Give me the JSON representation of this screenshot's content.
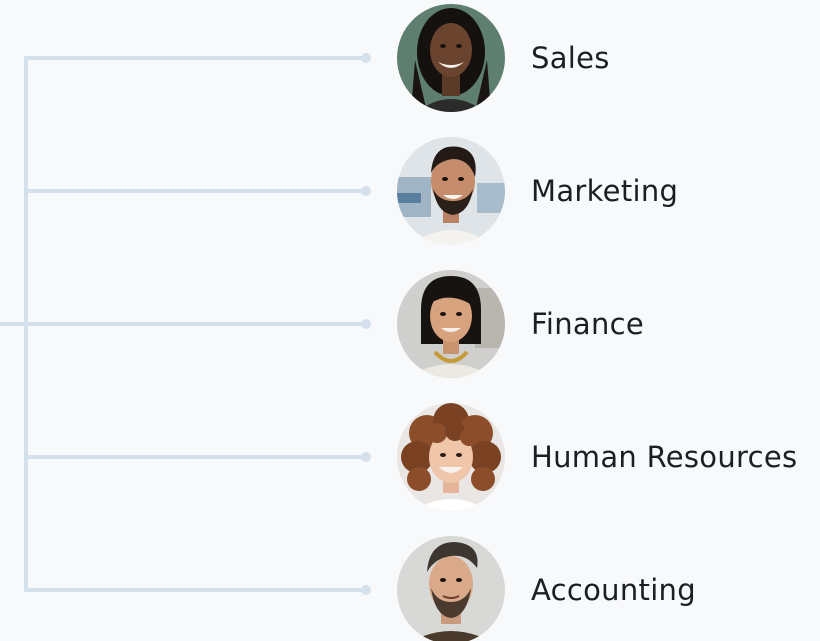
{
  "departments": [
    {
      "label": "Sales",
      "avatar": "woman-braids-avatar"
    },
    {
      "label": "Marketing",
      "avatar": "man-beard-smiling-avatar"
    },
    {
      "label": "Finance",
      "avatar": "woman-bob-necklace-avatar"
    },
    {
      "label": "Human Resources",
      "avatar": "woman-curly-hair-avatar"
    },
    {
      "label": "Accounting",
      "avatar": "man-undercut-beard-avatar"
    }
  ],
  "colors": {
    "connector": "#d4e1ec",
    "background": "#f8f9fb",
    "text": "#1b1f24"
  }
}
